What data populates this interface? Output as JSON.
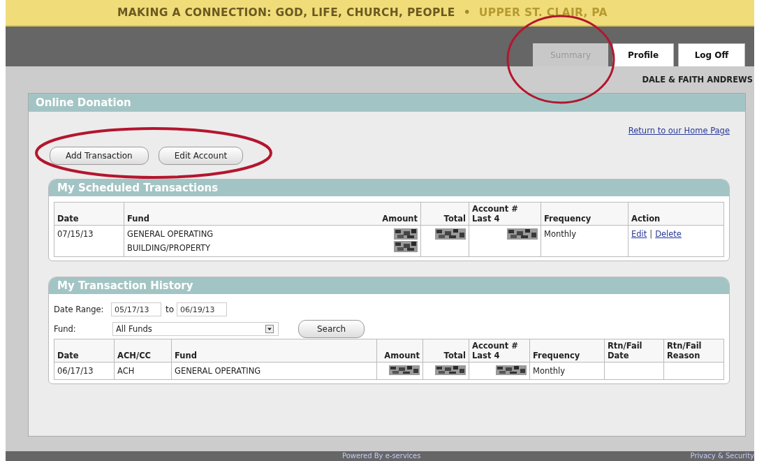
{
  "banner": {
    "tagline": "MAKING A CONNECTION: GOD, LIFE, CHURCH, PEOPLE",
    "separator": "•",
    "location": "UPPER ST. CLAIR, PA"
  },
  "tabs": [
    {
      "label": "Summary",
      "selected": true
    },
    {
      "label": "Profile",
      "selected": false
    },
    {
      "label": "Log Off",
      "selected": false
    }
  ],
  "user_name": "DALE & FAITH ANDREWS",
  "panel": {
    "title": "Online Donation",
    "home_link": "Return to our Home Page",
    "buttons": [
      "Add Transaction",
      "Edit Account"
    ]
  },
  "scheduled": {
    "title": "My Scheduled Transactions",
    "columns": [
      "Date",
      "Fund",
      "Amount",
      "Total",
      "Account # Last 4",
      "Frequency",
      "Action"
    ],
    "rows": [
      [
        {
          "kind": "text",
          "lines": [
            "07/15/13"
          ]
        },
        {
          "kind": "text",
          "lines": [
            "GENERAL OPERATING",
            "BUILDING/PROPERTY"
          ]
        },
        {
          "kind": "redacted-double"
        },
        {
          "kind": "redacted"
        },
        {
          "kind": "redacted"
        },
        {
          "kind": "text",
          "lines": [
            "Monthly"
          ]
        },
        {
          "kind": "links",
          "links": [
            "Edit",
            "Delete"
          ],
          "separator": "|"
        }
      ]
    ]
  },
  "history": {
    "title": "My Transaction History",
    "date_range_label": "Date Range:",
    "date_from": "05/17/13",
    "to_label": "to",
    "date_to": "06/19/13",
    "fund_label": "Fund:",
    "fund_value": "All Funds",
    "search_button": "Search",
    "columns": [
      "Date",
      "ACH/CC",
      "Fund",
      "Amount",
      "Total",
      "Account # Last 4",
      "Frequency",
      "Rtn/Fail Date",
      "Rtn/Fail Reason"
    ],
    "rows": [
      [
        {
          "kind": "text",
          "lines": [
            "06/17/13"
          ]
        },
        {
          "kind": "text",
          "lines": [
            "ACH"
          ]
        },
        {
          "kind": "text",
          "lines": [
            "GENERAL OPERATING"
          ]
        },
        {
          "kind": "redacted"
        },
        {
          "kind": "redacted"
        },
        {
          "kind": "redacted"
        },
        {
          "kind": "text",
          "lines": [
            "Monthly"
          ]
        },
        {
          "kind": "empty"
        },
        {
          "kind": "empty"
        }
      ]
    ]
  },
  "footer": {
    "powered_by": "Powered By e-services",
    "privacy": "Privacy & Security"
  }
}
